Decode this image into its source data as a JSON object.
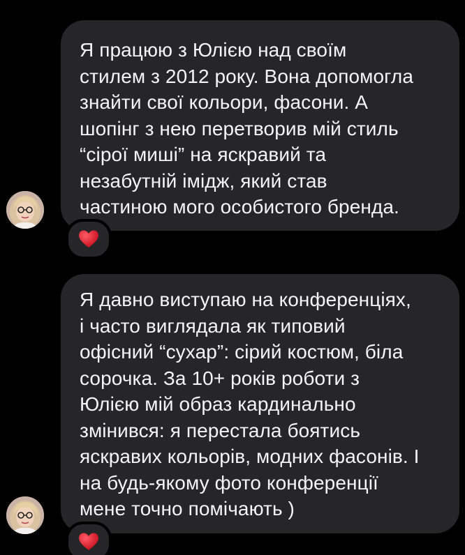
{
  "chat": {
    "messages": [
      {
        "text": "Я працюю з Юлією над своїм\nстилем з 2012 року. Вона допомогла\nзнайти свої кольори, фасони. А\nшопінг з нею перетворив мій стиль\n“сірої миші” на яскравий та\nнезабутній імідж, який став\nчастиною мого особистого бренда.",
        "reaction": "heart-icon"
      },
      {
        "text": "Я давно виступаю на конференціях,\nі часто виглядала як типовий\nофісний “сухар”: сірий костюм, біла\nсорочка. За 10+ років роботи з\nЮлією мій образ кардинально\nзмінився: я перестала боятись\nяскравих кольорів, модних фасонів. І\nна будь-якому фото конференції\nмене точно помічають )",
        "reaction": "heart-icon"
      }
    ]
  },
  "colors": {
    "background": "#000000",
    "bubble": "#262629",
    "text": "#f5f5f7",
    "reaction_heart": "#e0162b"
  }
}
